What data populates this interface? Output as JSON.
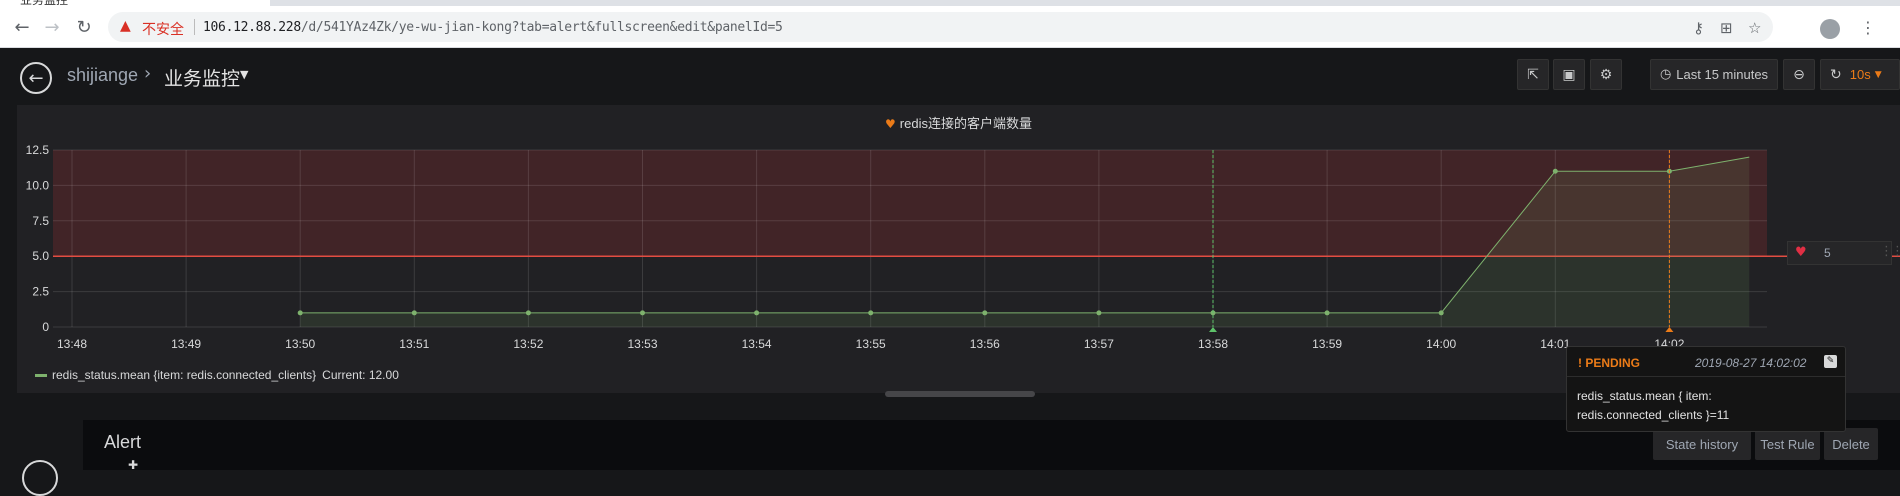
{
  "browser": {
    "tab_title": "业务监控",
    "insecure_label": "不安全",
    "url_host": "106.12.88.228",
    "url_path": "/d/541YAz4Zk/ye-wu-jian-kong?tab=alert&fullscreen&edit&panelId=5"
  },
  "nav": {
    "folder": "shijiange",
    "separator": "›",
    "dashboard": "业务监控",
    "time_range": "Last 15 minutes",
    "refresh_interval": "10s"
  },
  "panel": {
    "title": "redis连接的客户端数量",
    "legend_label": "redis_status.mean {item: redis.connected_clients}",
    "legend_current": "Current: 12.00",
    "threshold_value": "5"
  },
  "tooltip": {
    "state": "PENDING",
    "time": "2019-08-27 14:02:02",
    "message": "redis_status.mean { item: redis.connected_clients }=11"
  },
  "alert": {
    "title": "Alert",
    "state_history": "State history",
    "test_rule": "Test Rule",
    "delete": "Delete"
  },
  "colors": {
    "series": "#7eb26d",
    "threshold": "#e24d42",
    "accent": "#eb7b18"
  },
  "chart_data": {
    "type": "line",
    "title": "redis连接的客户端数量",
    "x_ticks": [
      "13:48",
      "13:49",
      "13:50",
      "13:51",
      "13:52",
      "13:53",
      "13:54",
      "13:55",
      "13:56",
      "13:57",
      "13:58",
      "13:59",
      "14:00",
      "14:01",
      "14:02"
    ],
    "y_ticks": [
      "0",
      "2.5",
      "5.0",
      "7.5",
      "10.0",
      "12.5"
    ],
    "ylim": [
      0,
      12.5
    ],
    "threshold": 5,
    "series": [
      {
        "name": "redis_status.mean {item: redis.connected_clients}",
        "x": [
          "13:50",
          "13:51",
          "13:52",
          "13:53",
          "13:54",
          "13:55",
          "13:56",
          "13:57",
          "13:58",
          "13:59",
          "14:00",
          "14:01",
          "14:02",
          "14:02:42"
        ],
        "y": [
          1,
          1,
          1,
          1,
          1,
          1,
          1,
          1,
          1,
          1,
          1,
          11,
          11,
          12
        ]
      }
    ],
    "annotations": [
      {
        "time": "13:58",
        "color": "#5ec26a"
      },
      {
        "time": "14:02",
        "color": "#eb7b18"
      }
    ],
    "grid": true,
    "legend": "bottom-left"
  }
}
